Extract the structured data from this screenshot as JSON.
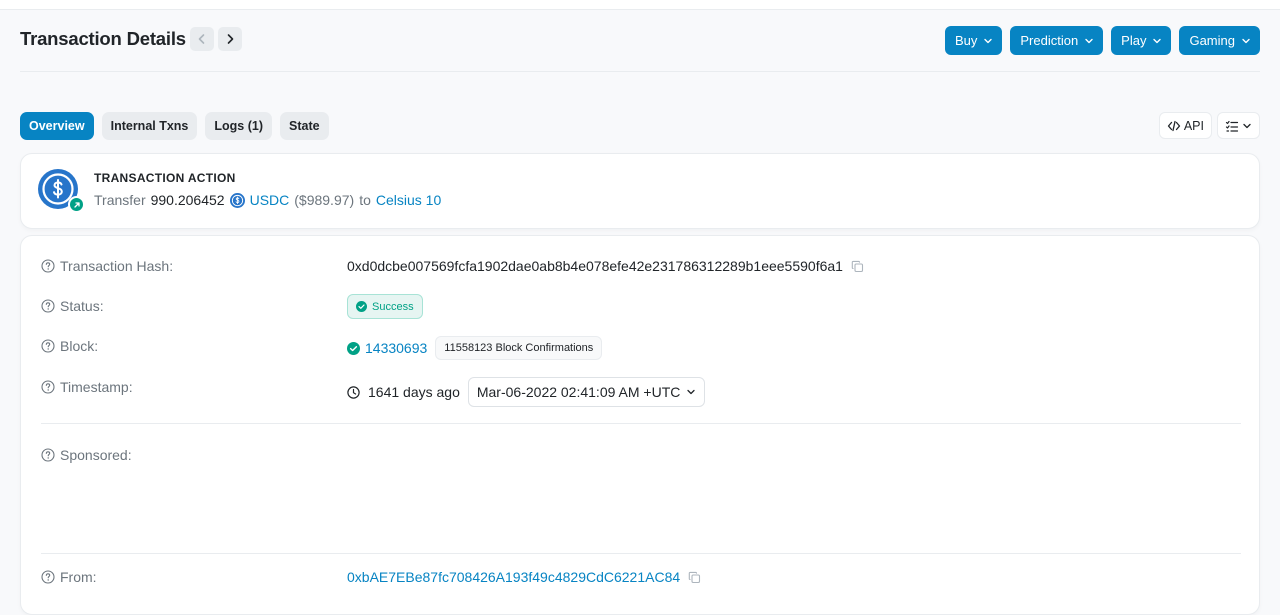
{
  "header": {
    "title": "Transaction Details",
    "menus": [
      {
        "label": "Buy"
      },
      {
        "label": "Prediction"
      },
      {
        "label": "Play"
      },
      {
        "label": "Gaming"
      }
    ]
  },
  "tabs": [
    {
      "label": "Overview",
      "active": true
    },
    {
      "label": "Internal Txns",
      "active": false
    },
    {
      "label": "Logs (1)",
      "active": false
    },
    {
      "label": "State",
      "active": false
    }
  ],
  "tools": {
    "api_label": "API"
  },
  "action": {
    "title": "TRANSACTION ACTION",
    "verb": "Transfer",
    "amount": "990.206452",
    "token": "USDC",
    "usd_value": "($989.97)",
    "to_word": "to",
    "recipient": "Celsius 10"
  },
  "details": {
    "hash_label": "Transaction Hash:",
    "hash_value": "0xd0dcbe007569fcfa1902dae0ab8b4e078efe42e231786312289b1eee5590f6a1",
    "status_label": "Status:",
    "status_value": "Success",
    "block_label": "Block:",
    "block_value": "14330693",
    "confirmations": "11558123 Block Confirmations",
    "timestamp_label": "Timestamp:",
    "age": "1641 days ago",
    "timestamp_value": "Mar-06-2022 02:41:09 AM +UTC",
    "sponsored_label": "Sponsored:",
    "from_label": "From:",
    "from_value": "0xbAE7EBe87fc708426A193f49c4829CdC6221AC84"
  },
  "colors": {
    "accent": "#0784c3",
    "success": "#00a186",
    "muted": "#6c757d"
  }
}
